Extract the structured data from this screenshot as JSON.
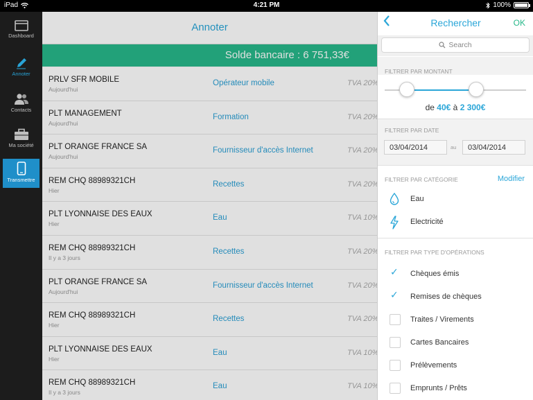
{
  "status_bar": {
    "device": "iPad",
    "time": "4:21 PM",
    "battery": "100%"
  },
  "sidebar": {
    "items": [
      {
        "label": "Dashboard",
        "icon": "dashboard-icon"
      },
      {
        "label": "Annoter",
        "icon": "pen-icon"
      },
      {
        "label": "Contacts",
        "icon": "contacts-icon"
      },
      {
        "label": "Ma société",
        "icon": "briefcase-icon"
      },
      {
        "label": "Transmettre",
        "icon": "phone-icon"
      }
    ]
  },
  "main": {
    "title": "Annoter",
    "solde": "Solde bancaire : 6 751,33€",
    "rows": [
      {
        "name": "PRLV SFR MOBILE",
        "date": "Aujourd'hui",
        "category": "Opérateur mobile",
        "tva": "TVA 20%"
      },
      {
        "name": "PLT MANAGEMENT",
        "date": "Aujourd'hui",
        "category": "Formation",
        "tva": "TVA 20%"
      },
      {
        "name": "PLT ORANGE FRANCE SA",
        "date": "Aujourd'hui",
        "category": "Fournisseur d'accès Internet",
        "tva": "TVA 20%"
      },
      {
        "name": "REM CHQ 88989321CH",
        "date": "Hier",
        "category": "Recettes",
        "tva": "TVA 20%"
      },
      {
        "name": "PLT LYONNAISE DES EAUX",
        "date": "Hier",
        "category": "Eau",
        "tva": "TVA 10%"
      },
      {
        "name": "REM CHQ 88989321CH",
        "date": "Il y a 3 jours",
        "category": "Recettes",
        "tva": "TVA 20%"
      },
      {
        "name": "PLT ORANGE FRANCE SA",
        "date": "Aujourd'hui",
        "category": "Fournisseur d'accès Internet",
        "tva": "TVA 20%"
      },
      {
        "name": "REM CHQ 88989321CH",
        "date": "Hier",
        "category": "Recettes",
        "tva": "TVA 20%"
      },
      {
        "name": "PLT LYONNAISE DES EAUX",
        "date": "Hier",
        "category": "Eau",
        "tva": "TVA 10%"
      },
      {
        "name": "REM CHQ 88989321CH",
        "date": "Il y a 3 jours",
        "category": "Eau",
        "tva": "TVA 10%"
      }
    ]
  },
  "panel": {
    "back": "<",
    "title": "Rechercher",
    "ok": "OK",
    "search_placeholder": "Search",
    "amount_header": "FILTRER PAR MONTANT",
    "amount": {
      "prefix": "de",
      "min": "40€",
      "sep": "à",
      "max": "2 300€"
    },
    "slider": {
      "min_fraction": 0.16,
      "max_fraction": 0.66
    },
    "date_header": "FILTRER PAR DATE",
    "date_from": "03/04/2014",
    "date_sep": "au",
    "date_to": "03/04/2014",
    "category_header": "FILTRER PAR CATÉGORIE",
    "modifier": "Modifier",
    "categories": [
      {
        "label": "Eau",
        "icon": "water-drop-icon"
      },
      {
        "label": "Electricité",
        "icon": "lightning-icon"
      }
    ],
    "operations_header": "FILTRER PAR TYPE D'OPÉRATIONS",
    "operations": [
      {
        "label": "Chèques émis",
        "checked": true
      },
      {
        "label": "Remises de chèques",
        "checked": true
      },
      {
        "label": "Traites / Virements",
        "checked": false
      },
      {
        "label": "Cartes Bancaires",
        "checked": false
      },
      {
        "label": "Prélèvements",
        "checked": false
      },
      {
        "label": "Emprunts / Prêts",
        "checked": false
      }
    ]
  },
  "colors": {
    "accent": "#2aa6d8",
    "green": "#27b88a",
    "sidebar": "#1c1c1c"
  }
}
